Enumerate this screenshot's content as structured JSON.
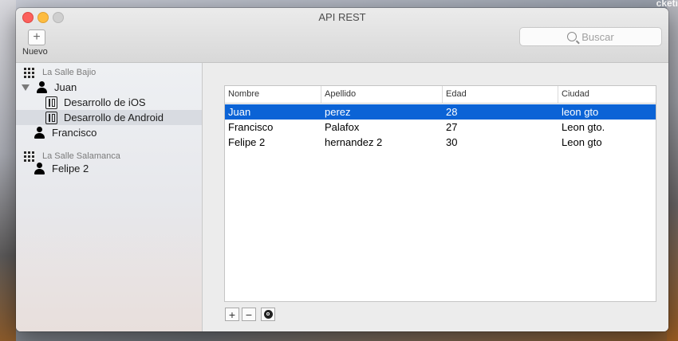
{
  "window": {
    "title": "API REST"
  },
  "desktop": {
    "corner_text": "cketi"
  },
  "toolbar": {
    "new_label": "Nuevo",
    "search_placeholder": "Buscar"
  },
  "sidebar": {
    "groups": [
      {
        "label": "La Salle Bajio",
        "icon": "building-icon"
      },
      {
        "label": "La Salle Salamanca",
        "icon": "building-icon"
      }
    ],
    "items": [
      {
        "label": "Juan",
        "icon": "person-icon",
        "expanded": true
      },
      {
        "label": "Desarrollo de iOS",
        "icon": "department-icon"
      },
      {
        "label": "Desarrollo de Android",
        "icon": "department-icon",
        "selected": true
      },
      {
        "label": "Francisco",
        "icon": "person-icon"
      },
      {
        "label": "Felipe 2",
        "icon": "person-icon"
      }
    ]
  },
  "table": {
    "columns": [
      "Nombre",
      "Apellido",
      "Edad",
      "Ciudad"
    ],
    "rows": [
      {
        "nombre": "Juan",
        "apellido": "perez",
        "edad": "28",
        "ciudad": "leon gto",
        "selected": true
      },
      {
        "nombre": "Francisco",
        "apellido": "Palafox",
        "edad": "27",
        "ciudad": "Leon gto."
      },
      {
        "nombre": "Felipe 2",
        "apellido": "hernandez 2",
        "edad": "30",
        "ciudad": "Leon gto"
      }
    ]
  },
  "table_controls": {
    "add_label": "+",
    "remove_label": "−"
  },
  "colors": {
    "selection": "#0b63d6",
    "sidebar_selection": "#d8dbe1"
  }
}
